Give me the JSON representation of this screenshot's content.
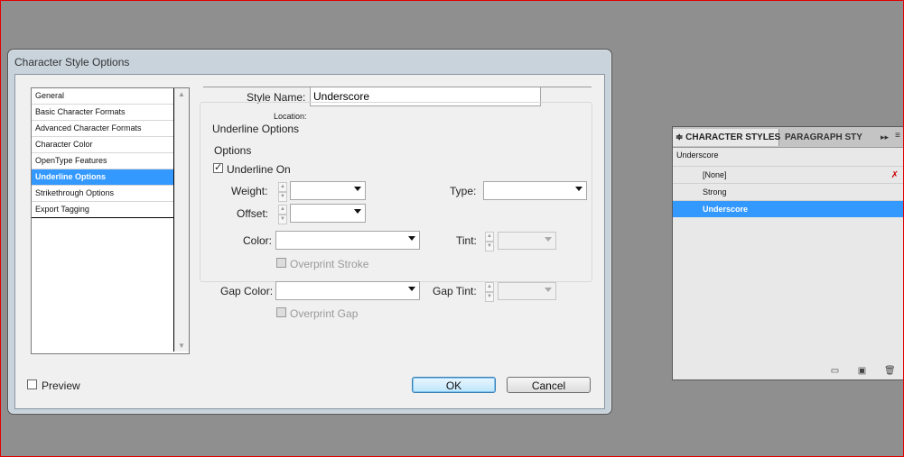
{
  "dialog": {
    "title": "Character Style Options",
    "sidebar_items": [
      "General",
      "Basic Character Formats",
      "Advanced Character Formats",
      "Character Color",
      "OpenType Features",
      "Underline Options",
      "Strikethrough Options",
      "Export Tagging"
    ],
    "selected_item": "Underline Options",
    "style_name_label": "Style Name:",
    "style_name_value": "Underscore",
    "location_label": "Location:",
    "section_title": "Underline Options",
    "options_group": "Options",
    "underline_on_label": "Underline On",
    "underline_on_checked": true,
    "weight_label": "Weight:",
    "offset_label": "Offset:",
    "type_label": "Type:",
    "color_label": "Color:",
    "tint_label": "Tint:",
    "overprint_stroke_label": "Overprint Stroke",
    "gap_color_label": "Gap Color:",
    "gap_tint_label": "Gap Tint:",
    "overprint_gap_label": "Overprint Gap",
    "preview_label": "Preview",
    "ok_label": "OK",
    "cancel_label": "Cancel"
  },
  "panel": {
    "tab_active": "CHARACTER STYLES",
    "tab_other": "PARAGRAPH STY",
    "current_style": "Underscore",
    "styles": [
      "[None]",
      "Strong",
      "Underscore"
    ],
    "selected_style": "Underscore"
  },
  "colors": {
    "selection": "#3399ff",
    "desktop": "#8f8f8f",
    "frame_border": "#e00000"
  }
}
